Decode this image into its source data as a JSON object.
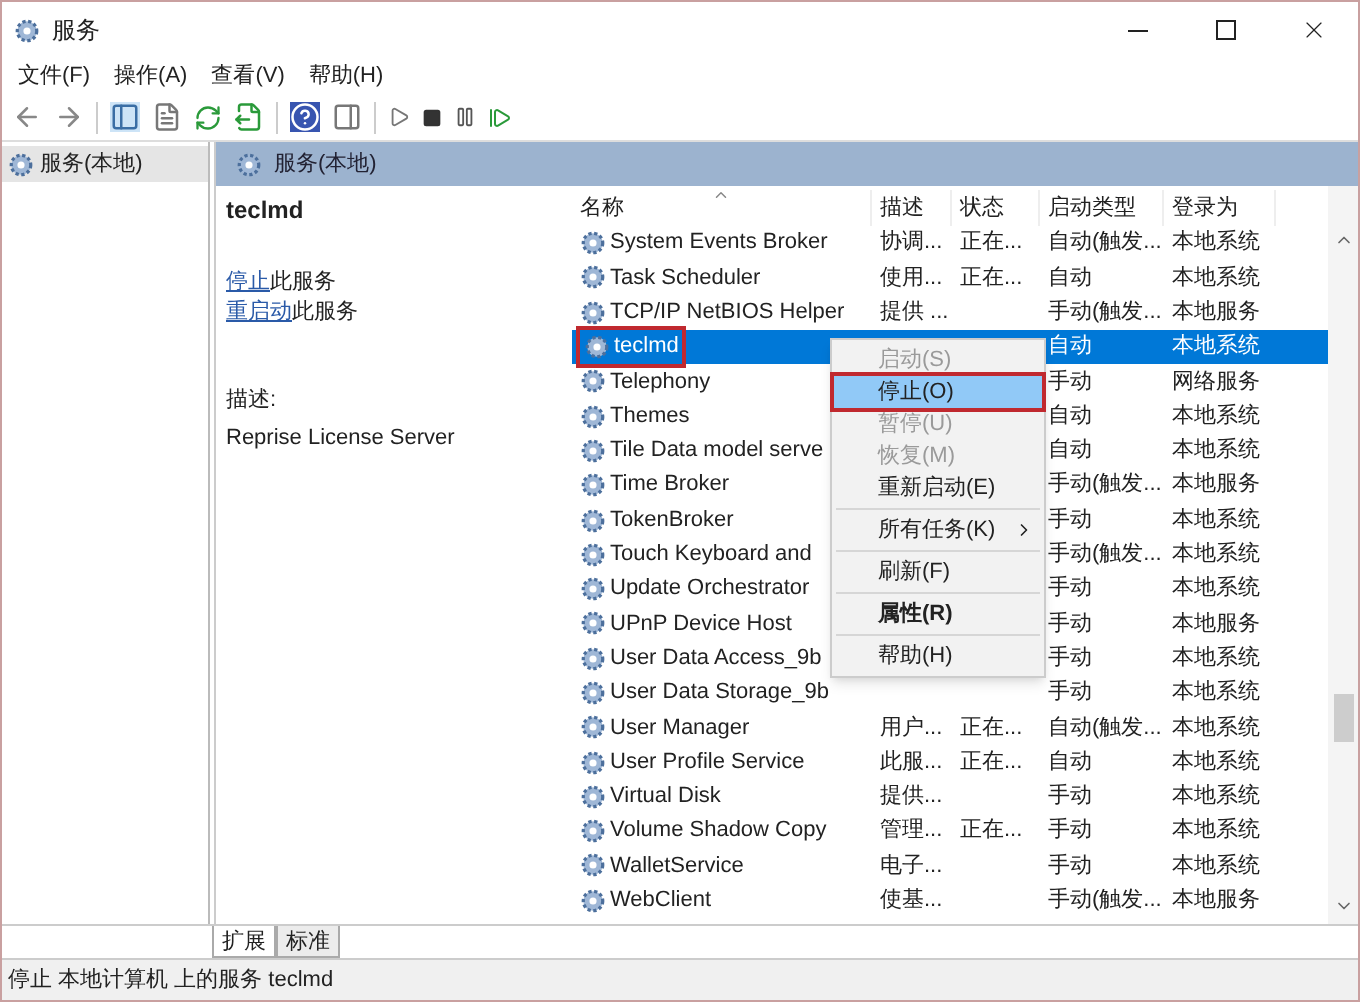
{
  "window": {
    "title": "服务"
  },
  "menu": [
    "文件(F)",
    "操作(A)",
    "查看(V)",
    "帮助(H)"
  ],
  "tree": [
    {
      "label": "服务(本地)",
      "selected": true
    }
  ],
  "pane_title": "服务(本地)",
  "detail": {
    "name": "teclmd",
    "actions": [
      {
        "link": "停止",
        "text": "此服务"
      },
      {
        "link": "重启动",
        "text": "此服务"
      }
    ],
    "desc_label": "描述:",
    "description": "Reprise License Server"
  },
  "table": {
    "columns": [
      "名称",
      "描述",
      "状态",
      "启动类型",
      "登录为"
    ],
    "rows": [
      {
        "cells": [
          "System Events Broker",
          "协调...",
          "正在...",
          "自动(触发...",
          "本地系统"
        ],
        "selected": false
      },
      {
        "cells": [
          "Task Scheduler",
          "使用...",
          "正在...",
          "自动",
          "本地系统"
        ],
        "selected": false
      },
      {
        "cells": [
          "TCP/IP NetBIOS Helper",
          "提供 ...",
          "",
          "手动(触发...",
          "本地服务"
        ],
        "selected": false
      },
      {
        "cells": [
          "teclmd",
          "",
          "",
          "自动",
          "本地系统"
        ],
        "selected": true,
        "highlighted": true
      },
      {
        "cells": [
          "Telephony",
          "",
          "",
          "手动",
          "网络服务"
        ],
        "selected": false
      },
      {
        "cells": [
          "Themes",
          "",
          "",
          "自动",
          "本地系统"
        ],
        "selected": false
      },
      {
        "cells": [
          "Tile Data model serve",
          "",
          "",
          "自动",
          "本地系统"
        ],
        "selected": false
      },
      {
        "cells": [
          "Time Broker",
          "",
          "",
          "手动(触发...",
          "本地服务"
        ],
        "selected": false
      },
      {
        "cells": [
          "TokenBroker",
          "",
          "",
          "手动",
          "本地系统"
        ],
        "selected": false
      },
      {
        "cells": [
          "Touch Keyboard and",
          "",
          "",
          "手动(触发...",
          "本地系统"
        ],
        "selected": false
      },
      {
        "cells": [
          "Update Orchestrator",
          "",
          "",
          "手动",
          "本地系统"
        ],
        "selected": false
      },
      {
        "cells": [
          "UPnP Device Host",
          "",
          "",
          "手动",
          "本地服务"
        ],
        "selected": false
      },
      {
        "cells": [
          "User Data Access_9b",
          "",
          "",
          "手动",
          "本地系统"
        ],
        "selected": false
      },
      {
        "cells": [
          "User Data Storage_9b",
          "",
          "",
          "手动",
          "本地系统"
        ],
        "selected": false
      },
      {
        "cells": [
          "User Manager",
          "用户...",
          "正在...",
          "自动(触发...",
          "本地系统"
        ],
        "selected": false
      },
      {
        "cells": [
          "User Profile Service",
          "此服...",
          "正在...",
          "自动",
          "本地系统"
        ],
        "selected": false
      },
      {
        "cells": [
          "Virtual Disk",
          "提供...",
          "",
          "手动",
          "本地系统"
        ],
        "selected": false
      },
      {
        "cells": [
          "Volume Shadow Copy",
          "管理...",
          "正在...",
          "手动",
          "本地系统"
        ],
        "selected": false
      },
      {
        "cells": [
          "WalletService",
          "电子...",
          "",
          "手动",
          "本地系统"
        ],
        "selected": false
      },
      {
        "cells": [
          "WebClient",
          "使基...",
          "",
          "手动(触发...",
          "本地服务"
        ],
        "selected": false
      }
    ]
  },
  "context_menu": [
    {
      "kind": "item",
      "label": "启动(S)",
      "disabled": true,
      "selected": false
    },
    {
      "kind": "item",
      "label": "停止(O)",
      "disabled": false,
      "selected": true,
      "highlighted": true
    },
    {
      "kind": "item",
      "label": "暂停(U)",
      "disabled": true,
      "selected": false
    },
    {
      "kind": "item",
      "label": "恢复(M)",
      "disabled": true,
      "selected": false
    },
    {
      "kind": "item",
      "label": "重新启动(E)",
      "disabled": false,
      "selected": false
    },
    {
      "kind": "separator"
    },
    {
      "kind": "item",
      "label": "所有任务(K)",
      "disabled": false,
      "selected": false,
      "submenu": true
    },
    {
      "kind": "separator"
    },
    {
      "kind": "item",
      "label": "刷新(F)",
      "disabled": false,
      "selected": false
    },
    {
      "kind": "separator"
    },
    {
      "kind": "item",
      "label": "属性(R)",
      "disabled": false,
      "selected": false,
      "bold": true
    },
    {
      "kind": "separator"
    },
    {
      "kind": "item",
      "label": "帮助(H)",
      "disabled": false,
      "selected": false
    }
  ],
  "tabs": [
    {
      "label": "扩展",
      "selected": true
    },
    {
      "label": "标准",
      "selected": false
    }
  ],
  "status_bar": "停止 本地计算机 上的服务 teclmd"
}
